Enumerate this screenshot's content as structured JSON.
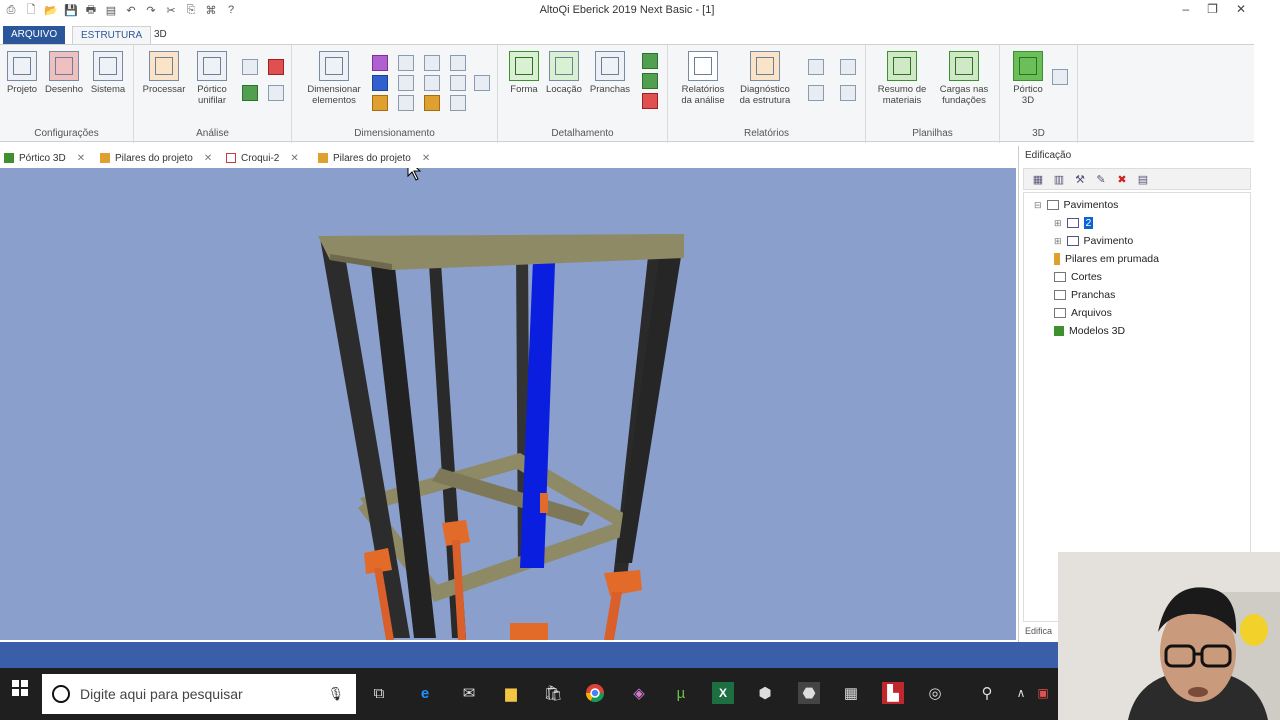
{
  "window": {
    "title": "AltoQi Eberick 2019 Next Basic - [1]",
    "minimize": "‒",
    "restore": "❐",
    "close": "✕"
  },
  "quick_access": [
    "⎙",
    "🗋",
    "📂",
    "💾",
    "🖶",
    "▤",
    "↶",
    "↷",
    "✂",
    "⎘",
    "⌘",
    "?"
  ],
  "ribbon_tabs": {
    "file": "ARQUIVO",
    "active": "ESTRUTURA",
    "three": "3D"
  },
  "ribbon": {
    "groups": [
      {
        "label": "Configurações",
        "buttons": [
          "Projeto",
          "Desenho",
          "Sistema"
        ]
      },
      {
        "label": "Análise",
        "buttons": [
          "Processar",
          "Pórtico unifilar"
        ]
      },
      {
        "label": "Dimensionamento",
        "buttons": [
          "Dimensionar elementos"
        ]
      },
      {
        "label": "Detalhamento",
        "buttons": [
          "Forma",
          "Locação",
          "Pranchas"
        ]
      },
      {
        "label": "Relatórios",
        "buttons": [
          "Relatórios da análise",
          "Diagnóstico da estrutura"
        ]
      },
      {
        "label": "Planilhas",
        "buttons": [
          "Resumo de materiais",
          "Cargas nas fundações"
        ]
      },
      {
        "label": "3D",
        "buttons": [
          "Pórtico 3D"
        ]
      }
    ]
  },
  "doc_tabs": [
    "Pórtico 3D",
    "Pilares do projeto",
    "Croqui-2",
    "Pilares do projeto"
  ],
  "doc_tab_close": "✕",
  "panel": {
    "title": "Edificação",
    "tools": [
      "▦",
      "▥",
      "⚒",
      "✎",
      "✖",
      "▤"
    ],
    "tree": {
      "pavimentos": "Pavimentos",
      "floor_selected": "2",
      "pavimento": "Pavimento",
      "pilares": "Pilares em prumada",
      "cortes": "Cortes",
      "pranchas": "Pranchas",
      "arquivos": "Arquivos",
      "modelos": "Modelos 3D"
    },
    "bottom_tab": "Edifica"
  },
  "taskbar": {
    "search_placeholder": "Digite aqui para pesquisar",
    "icons": [
      "task-view",
      "edge",
      "mail",
      "explorer",
      "store",
      "chrome",
      "app",
      "utorrent",
      "excel",
      "box",
      "eberick",
      "calculator",
      "pdf",
      "obs",
      "people"
    ]
  },
  "colors": {
    "viewport": "#8a9fcb",
    "selected_column": "#0a1ee0",
    "beam": "#8f8a66",
    "column": "#2e2e2e",
    "foundation": "#e36b2a",
    "status": "#3b5ea8"
  }
}
